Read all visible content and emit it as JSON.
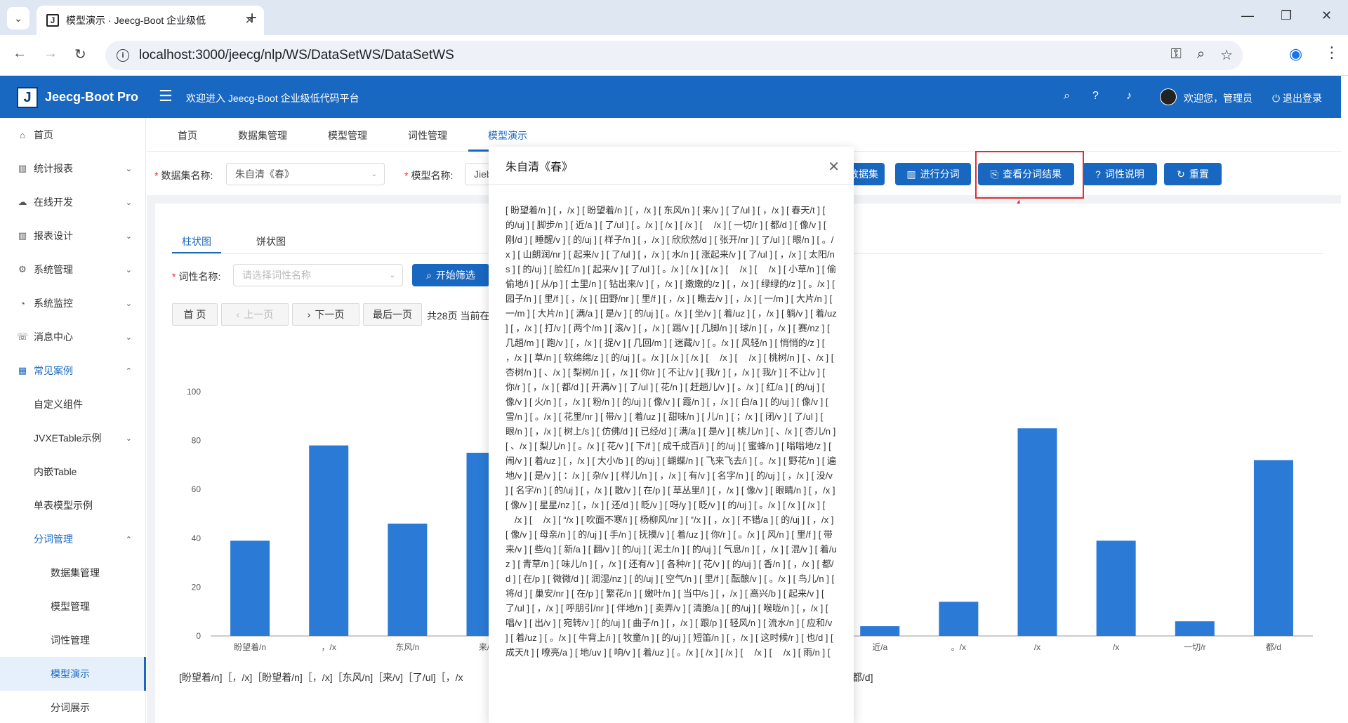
{
  "browser": {
    "tab_title": "模型演示 · Jeecg-Boot 企业级低",
    "url": "localhost:3000/jeecg/nlp/WS/DataSetWS/DataSetWS"
  },
  "header": {
    "app_name": "Jeecg-Boot Pro",
    "welcome": "欢迎进入 Jeecg-Boot 企业级低代码平台",
    "user_greeting": "欢迎您，管理员",
    "logout": "退出登录"
  },
  "sidebar": {
    "items": [
      {
        "label": "首页",
        "icon": "home-icon"
      },
      {
        "label": "统计报表",
        "icon": "chart-icon"
      },
      {
        "label": "在线开发",
        "icon": "cloud-icon"
      },
      {
        "label": "报表设计",
        "icon": "chart-icon"
      },
      {
        "label": "系统管理",
        "icon": "gear-icon"
      },
      {
        "label": "系统监控",
        "icon": "dashboard-icon"
      },
      {
        "label": "消息中心",
        "icon": "message-icon"
      },
      {
        "label": "常见案例",
        "icon": "grid-icon"
      },
      {
        "label": "自定义组件"
      },
      {
        "label": "JVXETable示例"
      },
      {
        "label": "内嵌Table"
      },
      {
        "label": "单表模型示例"
      },
      {
        "label": "分词管理"
      },
      {
        "label": "数据集管理"
      },
      {
        "label": "模型管理"
      },
      {
        "label": "词性管理"
      },
      {
        "label": "模型演示"
      },
      {
        "label": "分词展示"
      }
    ]
  },
  "tabs": [
    "首页",
    "数据集管理",
    "模型管理",
    "词性管理",
    "模型演示"
  ],
  "filters": {
    "dataset_label": "数据集名称:",
    "dataset_value": "朱自清《春》",
    "model_label": "模型名称:",
    "model_value": "Jieb"
  },
  "toolbar": {
    "dataset_btn": "数据集",
    "run_btn": "进行分词",
    "view_btn": "查看分词结果",
    "pos_btn": "词性说明",
    "reset_btn": "重置"
  },
  "inner_tabs": [
    "柱状图",
    "饼状图"
  ],
  "pos_filter": {
    "label": "词性名称:",
    "placeholder": "请选择词性名称",
    "search_btn": "开始筛选"
  },
  "pager": {
    "first": "首 页",
    "prev": "上一页",
    "next": "下一页",
    "last": "最后一页",
    "info": "共28页 当前在"
  },
  "chart_data": {
    "type": "bar",
    "ylim": [
      0,
      100
    ],
    "yticks": [
      0,
      20,
      40,
      60,
      80,
      100
    ],
    "categories": [
      "盼望着/n",
      "，/x",
      "东风/n",
      "来/v",
      "",
      "",
      "",
      "",
      "近/a",
      "。/x",
      "/x",
      "/x",
      "一切/r",
      "都/d"
    ],
    "values": [
      39,
      78,
      46,
      75,
      null,
      null,
      null,
      null,
      4,
      14,
      85,
      39,
      6,
      72
    ],
    "series_color": "#2b7bd6"
  },
  "segment_text_left": "[盼望着/n]［，/x]［盼望着/n]［，/x]［东风/n]［来/v]［了/ul]［，/x",
  "segment_text_right": "[都/d]",
  "modal": {
    "title": "朱自清《春》",
    "body": "[ 盼望着/n ] [ ，/x ] [ 盼望着/n ] [ ，/x ] [ 东风/n ] [ 来/v ] [ 了/ul ] [ ，/x ] [ 春天/t ] [ 的/uj ] [ 脚步/n ] [ 近/a ] [ 了/ul ] [ 。/x ] [ /x ] [ /x ] [ 　/x ] [ 一切/r ] [ 都/d ] [ 像/v ] [ 刚/d ] [ 睡醒/v ] [ 的/uj ] [ 样子/n ] [ ，/x ] [ 欣欣然/d ] [ 张开/nr ] [ 了/ul ] [ 眼/n ] [ 。/x ] [ 山朗润/nr ] [ 起来/v ] [ 了/ul ] [ ，/x ] [ 水/n ] [ 涨起来/v ] [ 了/ul ] [ ，/x ] [ 太阳/ns ] [ 的/uj ] [ 脸红/n ] [ 起来/v ] [ 了/ul ] [ 。/x ] [ /x ] [ /x ] [ 　/x ] [ 　/x ] [ 小草/n ] [ 偷偷地/i ] [ 从/p ] [ 土里/n ] [ 钻出来/v ] [ ，/x ] [ 嫩嫩的/z ] [ ，/x ] [ 绿绿的/z ] [ 。/x ] [ 园子/n ] [ 里/f ] [ ，/x ] [ 田野/nr ] [ 里/f ] [ ，/x ] [ 瞧去/v ] [ ，/x ] [ 一/m ] [ 大片/n ] [ 一/m ] [ 大片/n ] [ 满/a ] [ 是/v ] [ 的/uj ] [ 。/x ] [ 坐/v ] [ 着/uz ] [ ，/x ] [ 躺/v ] [ 着/uz ] [ ，/x ] [ 打/v ] [ 两个/m ] [ 滚/v ] [ ，/x ] [ 踢/v ] [ 几脚/n ] [ 球/n ] [ ，/x ] [ 赛/nz ] [ 几趟/m ] [ 跑/v ] [ ，/x ] [ 捉/v ] [ 几回/m ] [ 迷藏/v ] [ 。/x ] [ 风轻/n ] [ 悄悄的/z ] [ ，/x ] [ 草/n ] [ 软绵绵/z ] [ 的/uj ] [ 。/x ] [ /x ] [ /x ] [ 　/x ] [ 　/x ] [ 桃树/n ] [ 、/x ] [ 杏树/n ] [ 、/x ] [ 梨树/n ] [ ，/x ] [ 你/r ] [ 不让/v ] [ 我/r ] [ ，/x ] [ 我/r ] [ 不让/v ] [ 你/r ] [ ，/x ] [ 都/d ] [ 开满/v ] [ 了/ul ] [ 花/n ] [ 赶趟儿/v ] [ 。/x ] [ 红/a ] [ 的/uj ] [ 像/v ] [ 火/n ] [ ，/x ] [ 粉/n ] [ 的/uj ] [ 像/v ] [ 霞/n ] [ ，/x ] [ 白/a ] [ 的/uj ] [ 像/v ] [ 雪/n ] [ 。/x ] [ 花里/nr ] [ 带/v ] [ 着/uz ] [ 甜味/n ] [ 儿/n ] [ ；/x ] [ 闭/v ] [ 了/ul ] [ 眼/n ] [ ，/x ] [ 树上/s ] [ 仿佛/d ] [ 已经/d ] [ 满/a ] [ 是/v ] [ 桃儿/n ] [ 、/x ] [ 杏儿/n ] [ 、/x ] [ 梨儿/n ] [ 。/x ] [ 花/v ] [ 下/f ] [ 成千成百/i ] [ 的/uj ] [ 蜜蜂/n ] [ 嗡嗡地/z ] [ 闹/v ] [ 着/uz ] [ ，/x ] [ 大小/b ] [ 的/uj ] [ 蝴蝶/n ] [ 飞来飞去/i ] [ 。/x ] [ 野花/n ] [ 遍地/v ] [ 是/v ] [ ：/x ] [ 杂/v ] [ 样儿/n ] [ ，/x ] [ 有/v ] [ 名字/n ] [ 的/uj ] [ ，/x ] [ 没/v ] [ 名字/n ] [ 的/uj ] [ ，/x ] [ 散/v ] [ 在/p ] [ 草丛里/l ] [ ，/x ] [ 像/v ] [ 眼睛/n ] [ ，/x ] [ 像/v ] [ 星星/nz ] [ ，/x ] [ 还/d ] [ 眨/v ] [ 呀/y ] [ 眨/v ] [ 的/uj ] [ 。/x ] [ /x ] [ /x ] [ 　/x ] [ 　/x ] [ “/x ] [ 吹面不寒/i ] [ 杨柳风/nr ] [ ”/x ] [ ，/x ] [ 不错/a ] [ 的/uj ] [ ，/x ] [ 像/v ] [ 母亲/n ] [ 的/uj ] [ 手/n ] [ 抚摸/v ] [ 着/uz ] [ 你/r ] [ 。/x ] [ 风/n ] [ 里/f ] [ 带来/v ] [ 些/q ] [ 新/a ] [ 翻/v ] [ 的/uj ] [ 泥土/n ] [ 的/uj ] [ 气息/n ] [ ，/x ] [ 混/v ] [ 着/uz ] [ 青草/n ] [ 味儿/n ] [ ，/x ] [ 还有/v ] [ 各种/r ] [ 花/v ] [ 的/uj ] [ 香/n ] [ ，/x ] [ 都/d ] [ 在/p ] [ 微微/d ] [ 润湿/nz ] [ 的/uj ] [ 空气/n ] [ 里/f ] [ 酝酿/v ] [ 。/x ] [ 鸟儿/n ] [ 将/d ] [ 巢安/nr ] [ 在/p ] [ 繁花/n ] [ 嫩叶/n ] [ 当中/s ] [ ，/x ] [ 高兴/b ] [ 起来/v ] [ 了/ul ] [ ，/x ] [ 呼朋引/nr ] [ 伴地/n ] [ 卖弄/v ] [ 清脆/a ] [ 的/uj ] [ 喉咙/n ] [ ，/x ] [ 唱/v ] [ 出/v ] [ 宛转/v ] [ 的/uj ] [ 曲子/n ] [ ，/x ] [ 跟/p ] [ 轻风/n ] [ 流水/n ] [ 应和/v ] [ 着/uz ] [ 。/x ] [ 牛背上/i ] [ 牧童/n ] [ 的/uj ] [ 短笛/n ] [ ，/x ] [ 这时候/r ] [ 也/d ] [ 成天/t ] [ 嘹亮/a ] [ 地/uv ] [ 响/v ] [ 着/uz ] [ 。/x ] [ /x ] [ /x ] [ 　/x ] [ 　/x ] [ 雨/n ] ["
  }
}
